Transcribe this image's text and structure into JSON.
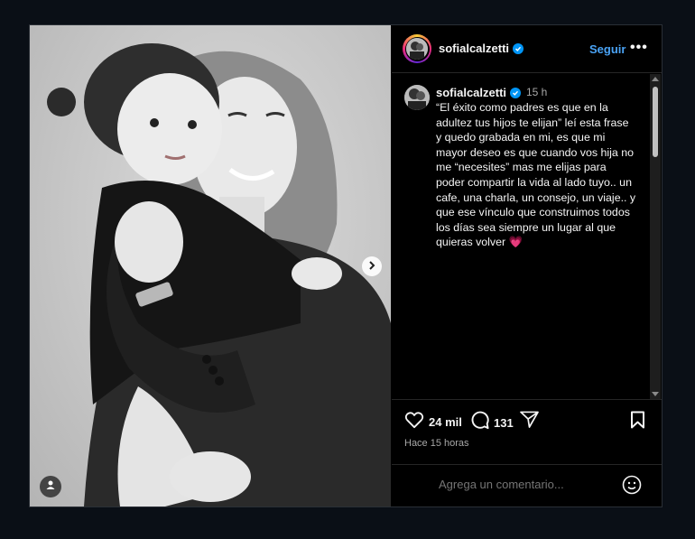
{
  "post": {
    "username": "sofialcalzetti",
    "follow_label": "Seguir",
    "more_label": "•••",
    "time": "15 h",
    "caption": "“El éxito como padres es que en la adultez tus hijos te elijan” leí esta frase y quedo grabada en mi, es que mi mayor deseo es que cuando vos hija no me “necesites” mas me elijas para poder compartir la vida al lado tuyo.. un cafe, una charla, un consejo, un viaje.. y que ese vínculo que construimos todos los días sea siempre un lugar al que quieras volver 💗",
    "likes": "24 mil",
    "comments_count": "131",
    "time_ago": "Hace 15 horas",
    "comment_placeholder": "Agrega un comentario..."
  },
  "colors": {
    "accent": "#4aa3f5",
    "verified": "#0095f6",
    "background": "#000000"
  },
  "icons": {
    "like": "heart-icon",
    "comment": "comment-icon",
    "share": "send-icon",
    "save": "bookmark-icon",
    "emoji": "emoji-icon",
    "next": "chevron-right-icon",
    "tag": "user-tag-icon"
  }
}
